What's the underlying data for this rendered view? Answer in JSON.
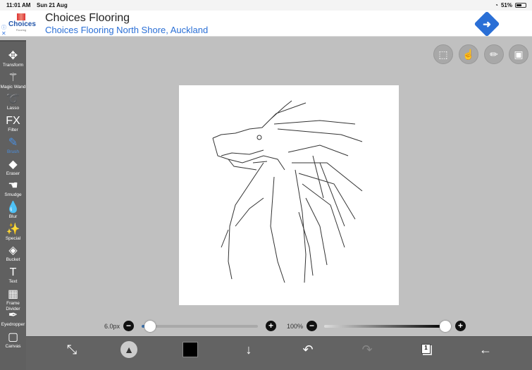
{
  "status": {
    "time": "11:01 AM",
    "date": "Sun 21 Aug",
    "battery": "51%"
  },
  "ad": {
    "logo_name": "Choices",
    "logo_sub": "Flooring",
    "title": "Choices Flooring",
    "subtitle": "Choices Flooring North Shore, Auckland",
    "info_icon": "ⓘ",
    "close_icon": "✕"
  },
  "tools": [
    {
      "label": "Transform",
      "icon": "✥"
    },
    {
      "label": "Magic Wand",
      "icon": "⚚"
    },
    {
      "label": "Lasso",
      "icon": "➰"
    },
    {
      "label": "Filter",
      "icon": "FX"
    },
    {
      "label": "Brush",
      "icon": "✎"
    },
    {
      "label": "Eraser",
      "icon": "◆"
    },
    {
      "label": "Smudge",
      "icon": "☚"
    },
    {
      "label": "Blur",
      "icon": "💧"
    },
    {
      "label": "Special",
      "icon": "✨"
    },
    {
      "label": "Bucket",
      "icon": "◈"
    },
    {
      "label": "Text",
      "icon": "T"
    },
    {
      "label": "Frame Divider",
      "icon": "▦"
    },
    {
      "label": "Eyedropper",
      "icon": "✒"
    },
    {
      "label": "Canvas",
      "icon": "▢"
    }
  ],
  "active_tool": "Brush",
  "brush": {
    "size_label": "6.0px",
    "size_fraction": 0.06,
    "opacity_label": "100%",
    "opacity_fraction": 1.0
  },
  "bottom": {
    "layer_count": "1"
  },
  "colors": {
    "accent": "#4a90e2",
    "current_color": "#000000"
  }
}
